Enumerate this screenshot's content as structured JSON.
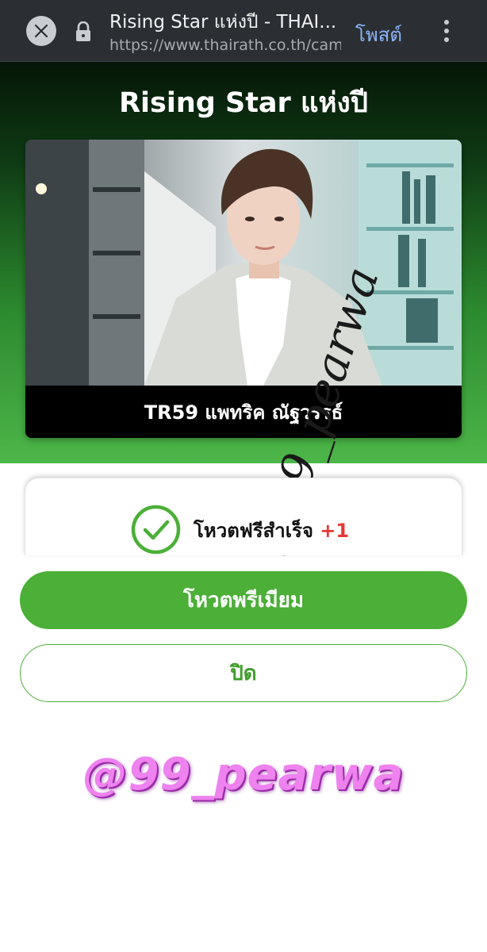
{
  "browser": {
    "title": "Rising Star แห่งปี - THAI...",
    "url": "https://www.thairath.co.th/cam",
    "post_label": "โพสต์"
  },
  "hero": {
    "title": "Rising Star แห่งปี",
    "candidate_caption": "TR59 แพทริค ณัฐวรรธ์"
  },
  "vote_result": {
    "message": "โหวตฟรีสำเร็จ",
    "points": "+1"
  },
  "buttons": {
    "premium": "โหวตพรีเมียม",
    "close": "ปิด"
  },
  "watermark": {
    "text": "@99_pearwa",
    "handwritten": "@99_pearwa"
  },
  "colors": {
    "accent_green": "#4caf38",
    "plus_red": "#e53935",
    "watermark_pink": "#ee82ee"
  },
  "icons": [
    "close-icon",
    "lock-icon",
    "more-vert-icon",
    "check-circle-icon"
  ]
}
